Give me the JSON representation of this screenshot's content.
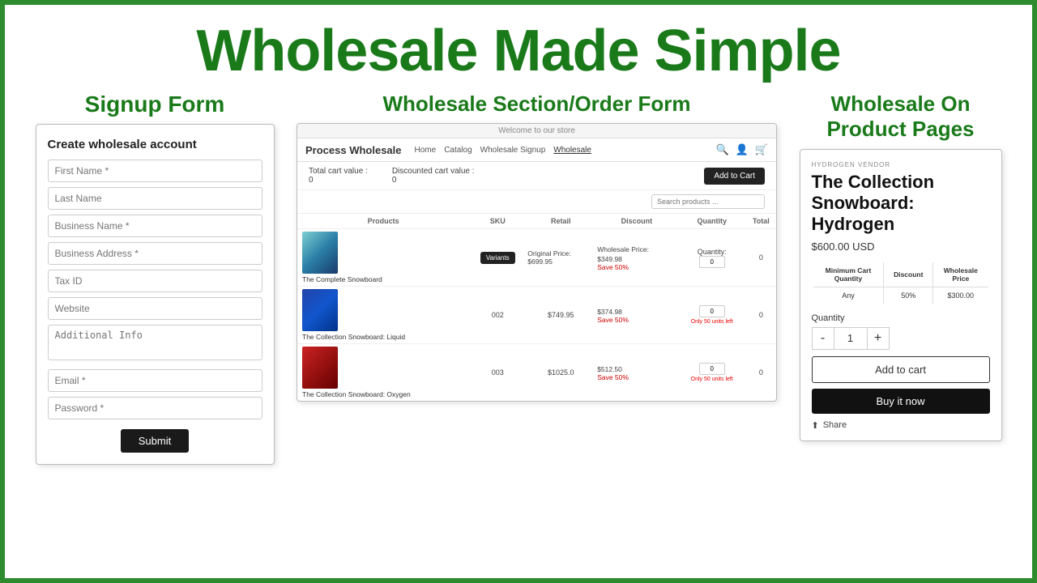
{
  "page": {
    "border_color": "#2e8b2e",
    "main_title": "Wholesale Made Simple"
  },
  "section1": {
    "title": "Signup Form",
    "card_title": "Create wholesale account",
    "fields": [
      {
        "placeholder": "First Name *",
        "type": "text"
      },
      {
        "placeholder": "Last Name",
        "type": "text"
      },
      {
        "placeholder": "Business Name *",
        "type": "text"
      },
      {
        "placeholder": "Business Address *",
        "type": "text"
      },
      {
        "placeholder": "Tax ID",
        "type": "text"
      },
      {
        "placeholder": "Website",
        "type": "text"
      },
      {
        "placeholder": "Additional Info",
        "type": "textarea"
      },
      {
        "placeholder": "Email *",
        "type": "text"
      },
      {
        "placeholder": "Password *",
        "type": "text"
      }
    ],
    "submit_label": "Submit"
  },
  "section2": {
    "title": "Wholesale Section/Order Form",
    "top_bar": "Welcome to our store",
    "brand": "Process Wholesale",
    "nav_links": [
      "Home",
      "Catalog",
      "Wholesale Signup",
      "Wholesale"
    ],
    "cart_labels": [
      "Total cart value :",
      "Discounted cart value :"
    ],
    "cart_values": [
      "0",
      "0"
    ],
    "add_to_cart_label": "Add to Cart",
    "search_placeholder": "Search products ...",
    "table_headers": [
      "Products",
      "SKU",
      "Retail",
      "Discount",
      "Quantity",
      "Total"
    ],
    "products": [
      {
        "name": "The Complete Snowboard",
        "sku": "",
        "retail": "Original Price:\n$699.95",
        "wholesale": "Wholesale Price:\n$349.98",
        "save": "Save 50%",
        "has_variants": true,
        "qty": "0",
        "total": "0",
        "img_class": "product-img-placeholder"
      },
      {
        "name": "The Collection Snowboard: Liquid",
        "sku": "002",
        "retail": "$749.95",
        "wholesale": "$374.98",
        "save": "Save 50%",
        "has_variants": false,
        "qty": "0",
        "qty_note": "Only 50 units left",
        "total": "0",
        "img_class": "product-img-placeholder product-img-2"
      },
      {
        "name": "The Collection Snowboard: Oxygen",
        "sku": "003",
        "retail": "$1025.0",
        "wholesale": "$512.50",
        "save": "Save 50%",
        "has_variants": false,
        "qty": "0",
        "qty_note": "Only 50 units left",
        "total": "0",
        "img_class": "product-img-placeholder product-img-3"
      }
    ]
  },
  "section3": {
    "title": "Wholesale On\nProduct Pages",
    "vendor": "HYDROGEN VENDOR",
    "product_title": "The Collection Snowboard: Hydrogen",
    "price": "$600.00 USD",
    "wholesale_table": {
      "headers": [
        "Minimum Cart\nQuantity",
        "Discount",
        "Wholesale\nPrice"
      ],
      "rows": [
        {
          "min_qty": "Any",
          "discount": "50%",
          "price": "$300.00"
        }
      ]
    },
    "quantity_label": "Quantity",
    "quantity_value": "1",
    "qty_minus": "-",
    "qty_plus": "+",
    "add_to_cart_label": "Add to cart",
    "buy_now_label": "Buy it now",
    "share_label": "Share"
  }
}
